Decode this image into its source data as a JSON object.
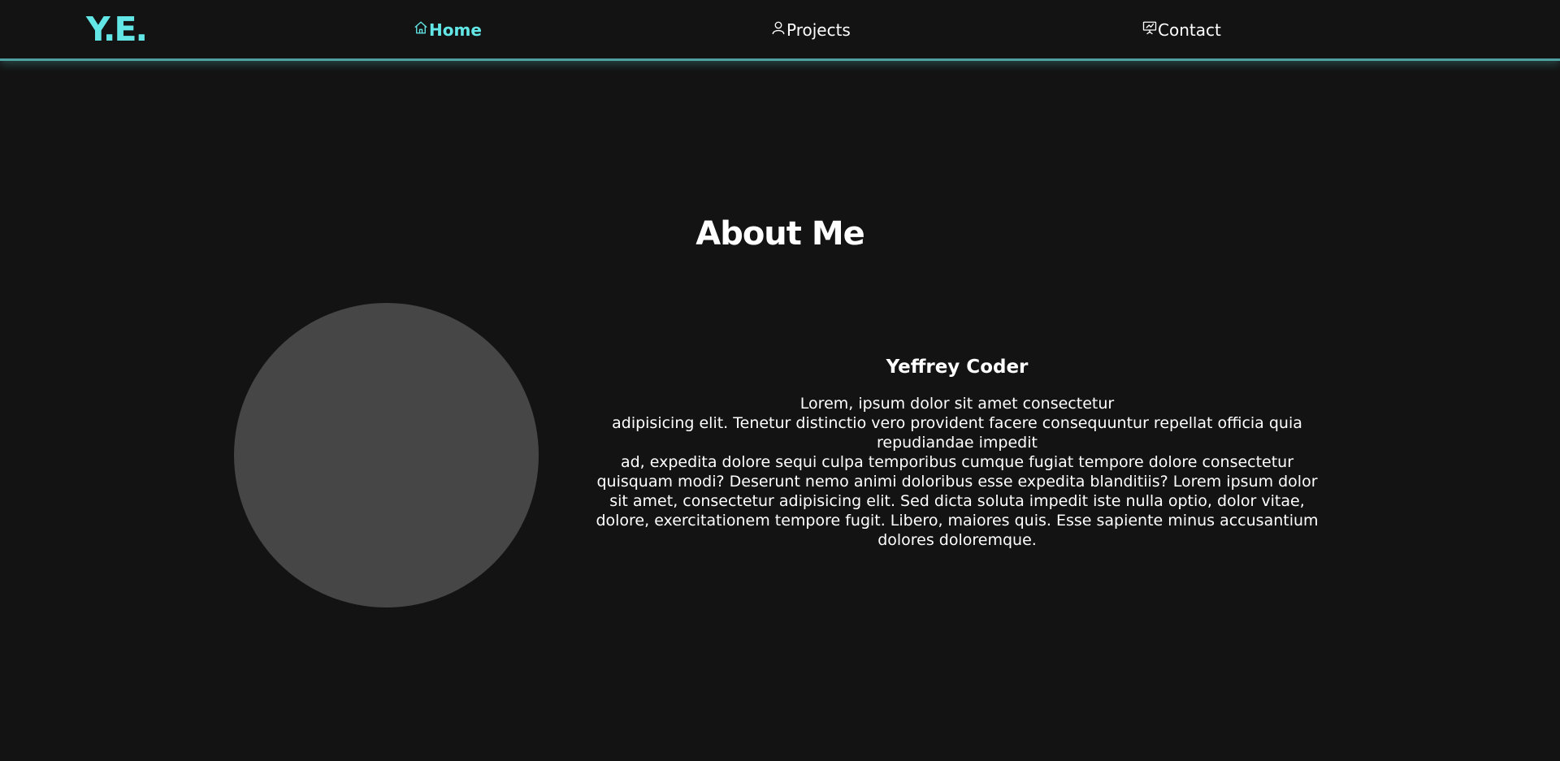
{
  "colors": {
    "background": "#131313",
    "accent": "#63e6e6",
    "nav_border": "#4fa1a1",
    "avatar": "#464646",
    "text": "#ffffff"
  },
  "header": {
    "logo": "Y.E.",
    "nav": [
      {
        "label": "Home",
        "icon": "home-icon",
        "active": true
      },
      {
        "label": "Projects",
        "icon": "user-icon",
        "active": false
      },
      {
        "label": "Contact",
        "icon": "presentation-icon",
        "active": false
      }
    ]
  },
  "about": {
    "title": "About Me",
    "name": "Yeffrey Coder",
    "bio_lines": [
      "Lorem, ipsum dolor sit amet consectetur",
      "adipisicing elit. Tenetur distinctio vero provident facere consequuntur repellat officia quia repudiandae impedit",
      "ad, expedita dolore sequi culpa temporibus cumque fugiat tempore dolore consectetur quisquam modi? Deserunt nemo animi doloribus esse expedita blanditiis? Lorem ipsum dolor sit amet, consectetur adipisicing elit. Sed dicta soluta impedit iste nulla optio, dolor vitae, dolore, exercitationem tempore fugit. Libero, maiores quis. Esse sapiente minus accusantium dolores doloremque."
    ]
  }
}
